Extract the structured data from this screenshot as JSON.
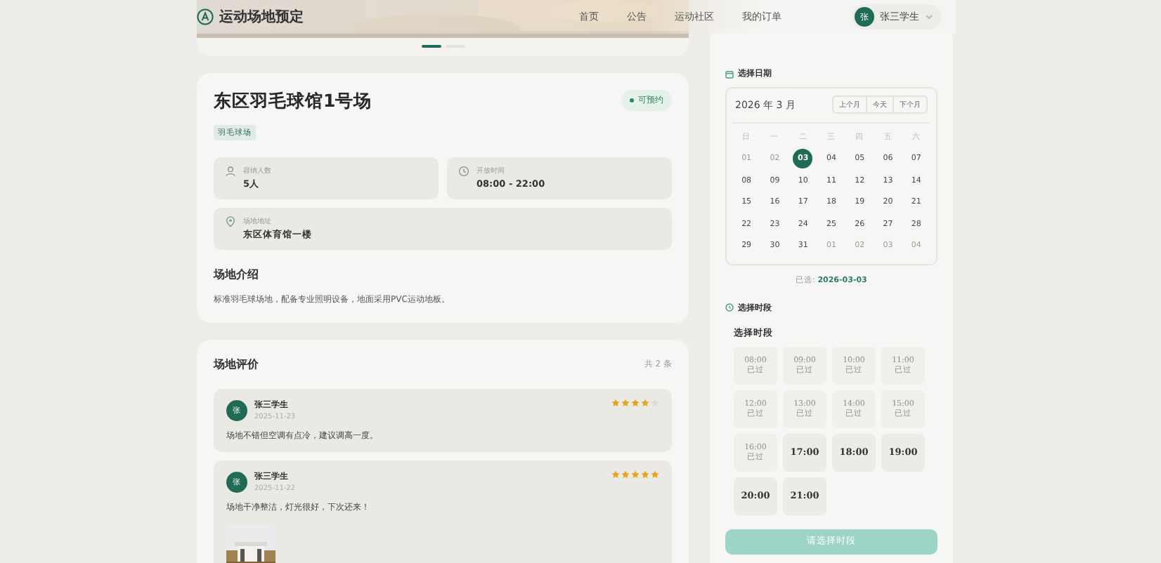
{
  "header": {
    "title": "运动场地预定",
    "nav": [
      {
        "label": "首页"
      },
      {
        "label": "公告"
      },
      {
        "label": "运动社区"
      },
      {
        "label": "我的订单"
      }
    ],
    "user": {
      "avatar": "张",
      "name": "张三学生"
    }
  },
  "banner": {
    "kind": "picture",
    "dots": [
      {
        "selected": true
      },
      {
        "selected": false
      }
    ]
  },
  "venue": {
    "name": "东区羽毛球馆1号场",
    "status": "可预约",
    "tag": "羽毛球场",
    "facts": [
      {
        "kind": "people",
        "label": "容纳人数",
        "value": "5人"
      },
      {
        "kind": "clock",
        "label": "开放时间",
        "value": "08:00 - 22:00"
      },
      {
        "kind": "pin",
        "label": "场地地址",
        "value": "东区体育馆一楼"
      }
    ],
    "intro_title": "场地介绍",
    "intro": "标准羽毛球场地，配备专业照明设备，地面采用PVC运动地板。"
  },
  "reviews": {
    "title": "场地评价",
    "count": "共 2 条",
    "items": [
      {
        "avatar": "张",
        "name": "张三学生",
        "date": "2025-11-23",
        "stars": 4,
        "text": "场地不错但空调有点冷，建议调高一度。",
        "photo": false
      },
      {
        "avatar": "张",
        "name": "张三学生",
        "date": "2025-11-22",
        "stars": 5,
        "text": "场地干净整洁，灯光很好，下次还来！",
        "photo": true
      }
    ]
  },
  "booking": {
    "date_label": "选择日期",
    "month": "2026 年 3 月",
    "nav": [
      {
        "label": "上个月"
      },
      {
        "label": "今天"
      },
      {
        "label": "下个月"
      }
    ],
    "weekdays": [
      "日",
      "一",
      "二",
      "三",
      "四",
      "五",
      "六"
    ],
    "days": [
      {
        "label": "01",
        "muted": true,
        "selected": false
      },
      {
        "label": "02",
        "muted": true,
        "selected": false
      },
      {
        "label": "03",
        "muted": false,
        "selected": true
      },
      {
        "label": "04",
        "muted": false,
        "selected": false
      },
      {
        "label": "05",
        "muted": false,
        "selected": false
      },
      {
        "label": "06",
        "muted": false,
        "selected": false
      },
      {
        "label": "07",
        "muted": false,
        "selected": false
      },
      {
        "label": "08",
        "muted": false,
        "selected": false
      },
      {
        "label": "09",
        "muted": false,
        "selected": false
      },
      {
        "label": "10",
        "muted": false,
        "selected": false
      },
      {
        "label": "11",
        "muted": false,
        "selected": false
      },
      {
        "label": "12",
        "muted": false,
        "selected": false
      },
      {
        "label": "13",
        "muted": false,
        "selected": false
      },
      {
        "label": "14",
        "muted": false,
        "selected": false
      },
      {
        "label": "15",
        "muted": false,
        "selected": false
      },
      {
        "label": "16",
        "muted": false,
        "selected": false
      },
      {
        "label": "17",
        "muted": false,
        "selected": false
      },
      {
        "label": "18",
        "muted": false,
        "selected": false
      },
      {
        "label": "19",
        "muted": false,
        "selected": false
      },
      {
        "label": "20",
        "muted": false,
        "selected": false
      },
      {
        "label": "21",
        "muted": false,
        "selected": false
      },
      {
        "label": "22",
        "muted": false,
        "selected": false
      },
      {
        "label": "23",
        "muted": false,
        "selected": false
      },
      {
        "label": "24",
        "muted": false,
        "selected": false
      },
      {
        "label": "25",
        "muted": false,
        "selected": false
      },
      {
        "label": "26",
        "muted": false,
        "selected": false
      },
      {
        "label": "27",
        "muted": false,
        "selected": false
      },
      {
        "label": "28",
        "muted": false,
        "selected": false
      },
      {
        "label": "29",
        "muted": false,
        "selected": false
      },
      {
        "label": "30",
        "muted": false,
        "selected": false
      },
      {
        "label": "31",
        "muted": false,
        "selected": false
      },
      {
        "label": "01",
        "muted": true,
        "selected": false
      },
      {
        "label": "02",
        "muted": true,
        "selected": false
      },
      {
        "label": "03",
        "muted": true,
        "selected": false
      },
      {
        "label": "04",
        "muted": true,
        "selected": false
      }
    ],
    "selected_prefix": "已选:",
    "selected_date": "2026-03-03",
    "time_label": "选择时段",
    "slots_title": "选择时段",
    "slots": [
      {
        "time": "08:00",
        "disabled": true,
        "status": "已过"
      },
      {
        "time": "09:00",
        "disabled": true,
        "status": "已过"
      },
      {
        "time": "10:00",
        "disabled": true,
        "status": "已过"
      },
      {
        "time": "11:00",
        "disabled": true,
        "status": "已过"
      },
      {
        "time": "12:00",
        "disabled": true,
        "status": "已过"
      },
      {
        "time": "13:00",
        "disabled": true,
        "status": "已过"
      },
      {
        "time": "14:00",
        "disabled": true,
        "status": "已过"
      },
      {
        "time": "15:00",
        "disabled": true,
        "status": "已过"
      },
      {
        "time": "16:00",
        "disabled": true,
        "status": "已过"
      },
      {
        "time": "17:00",
        "disabled": false
      },
      {
        "time": "18:00",
        "disabled": false
      },
      {
        "time": "19:00",
        "disabled": false
      },
      {
        "time": "20:00",
        "disabled": false
      },
      {
        "time": "21:00",
        "disabled": false
      }
    ],
    "submit": {
      "label": "请选择时段",
      "disabled": true
    }
  }
}
